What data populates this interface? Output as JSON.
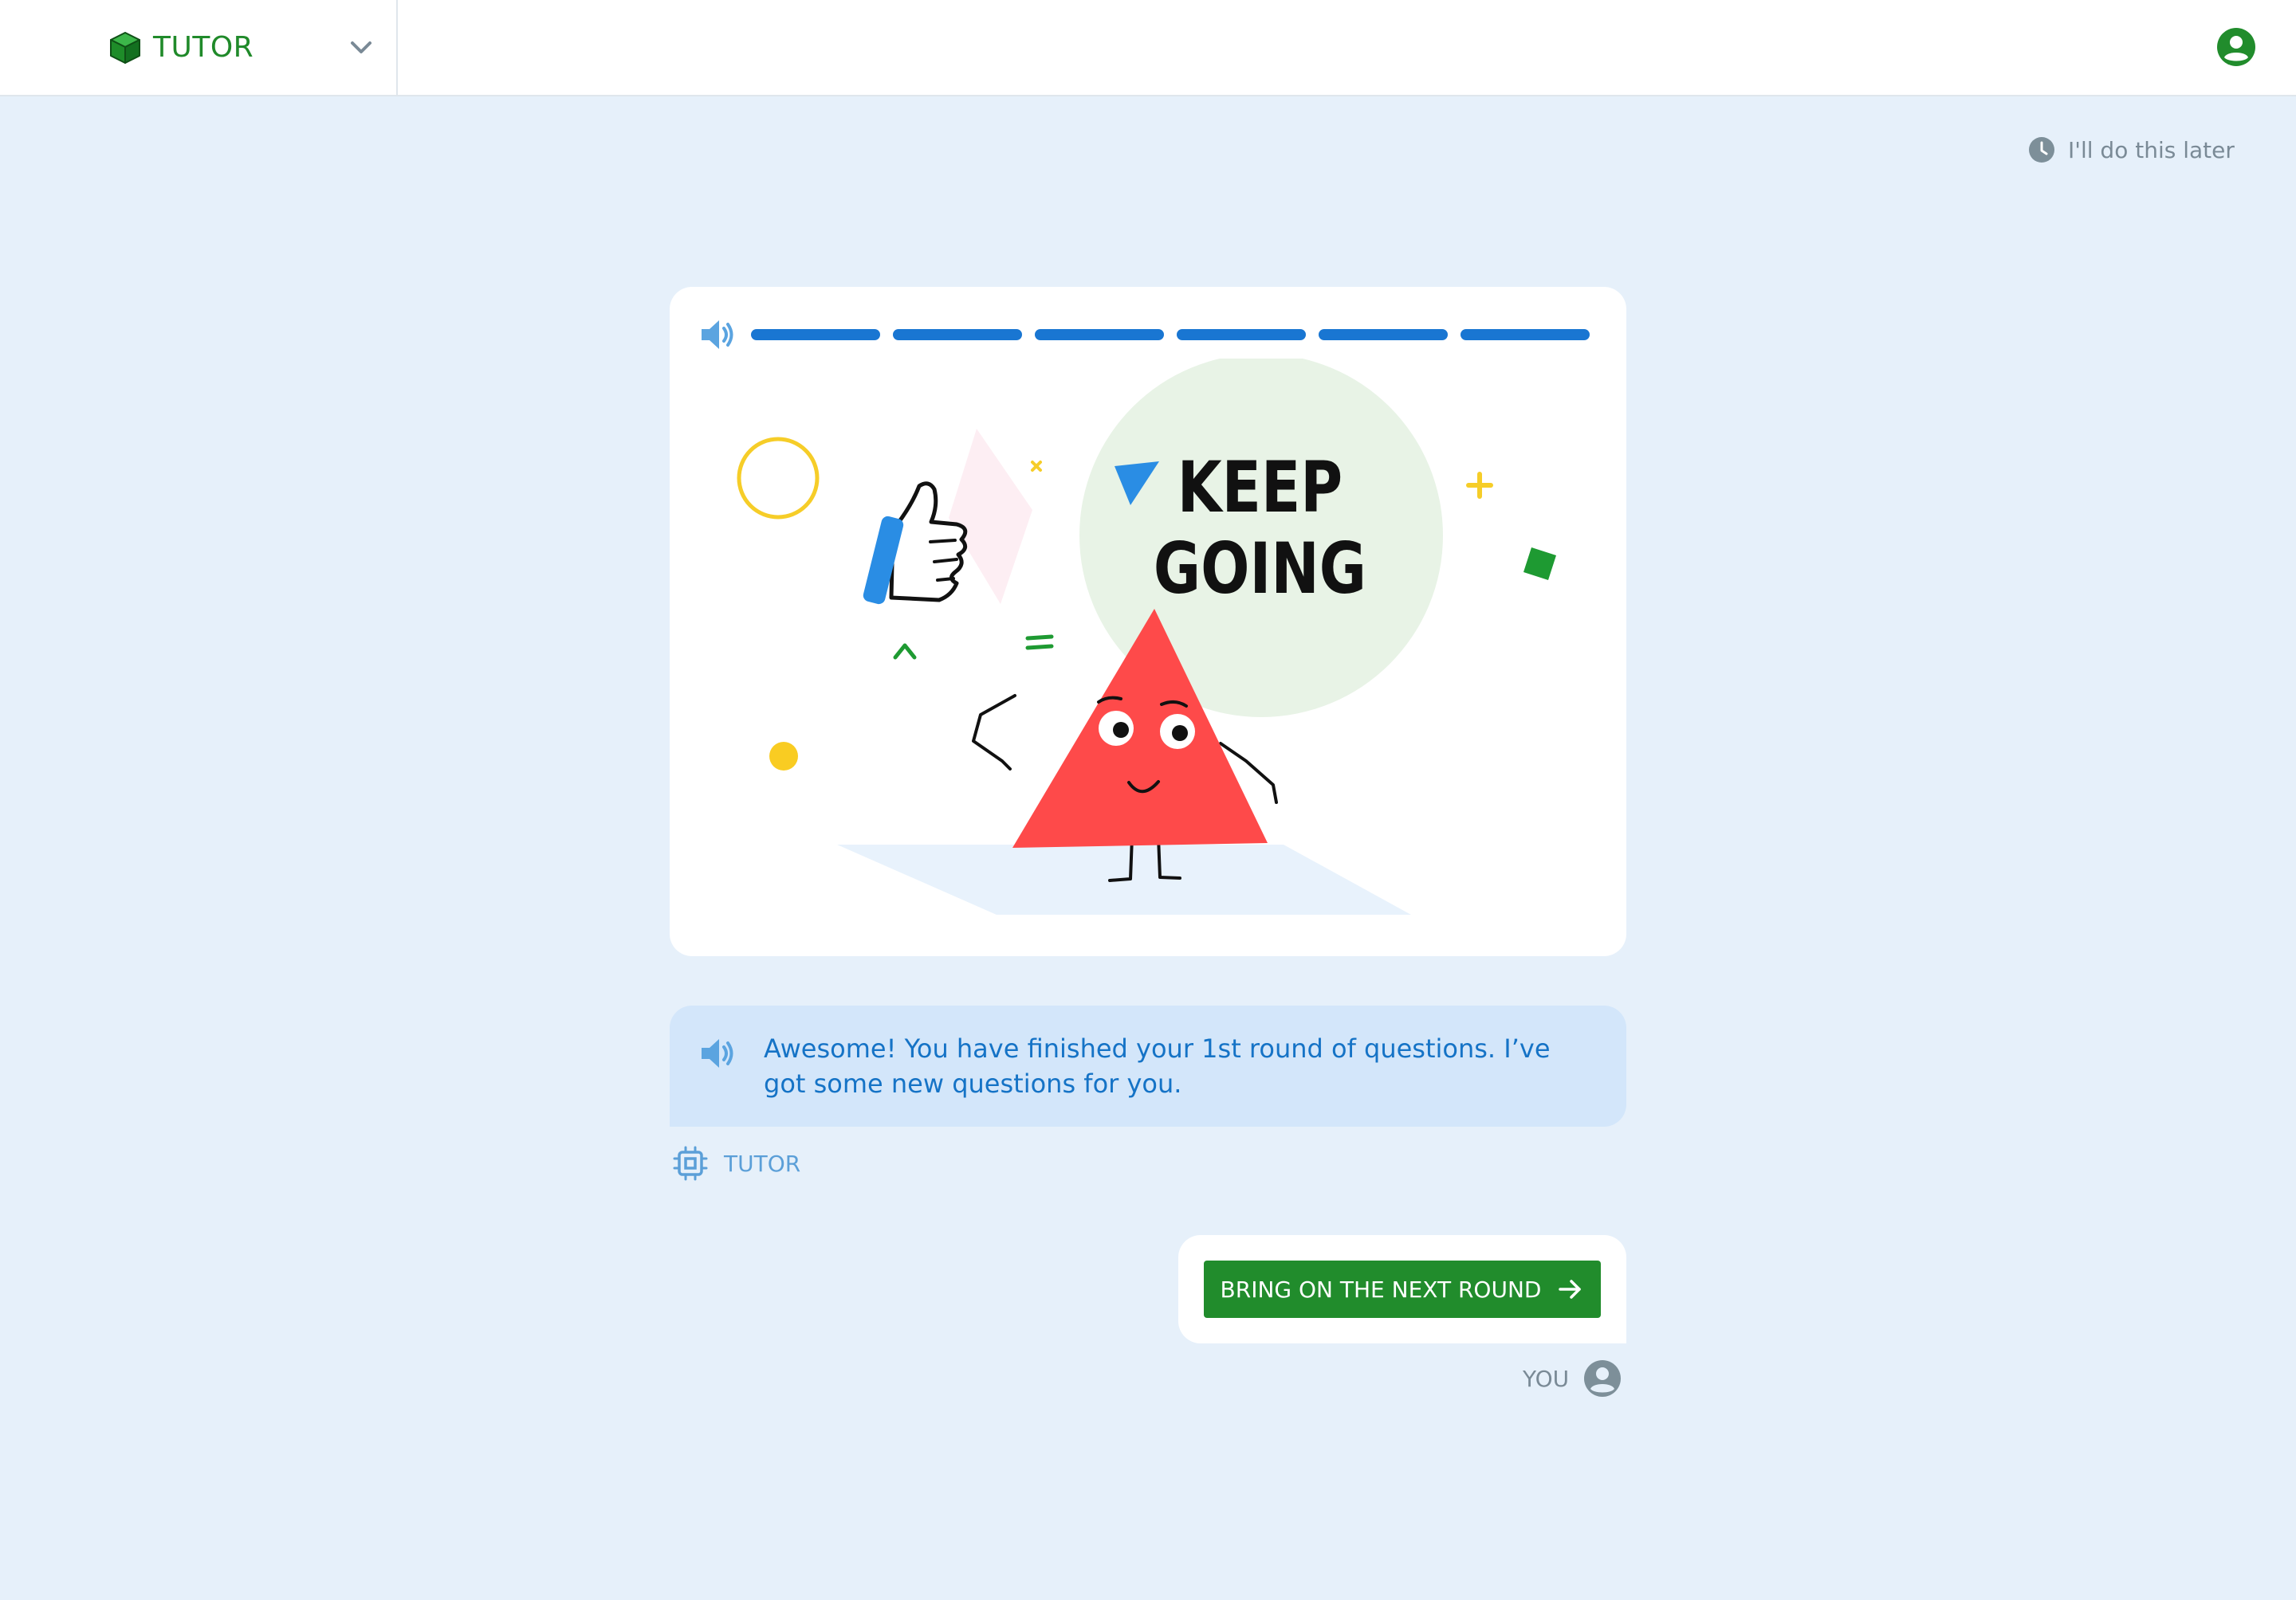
{
  "header": {
    "brand_name": "TUTOR",
    "brand_icon": "cube-icon",
    "dropdown_icon": "chevron-down-icon",
    "account_icon": "account-circle-icon",
    "accent_color": "#208a2a"
  },
  "later_link": {
    "label": "I'll do this later",
    "icon": "clock-icon"
  },
  "card": {
    "audio_icon": "speaker-icon",
    "progress": {
      "completed_segments": 6,
      "total_segments": 6,
      "color": "#1976d2"
    },
    "illustration": {
      "headline_line1": "KEEP",
      "headline_line2": "GOING"
    }
  },
  "tutor_message": {
    "text": "Awesome! You have finished your 1st round of questions. I’ve got some new questions for you.",
    "audio_icon": "speaker-icon",
    "sender_label": "TUTOR",
    "sender_icon": "chip-icon"
  },
  "user_reply": {
    "button_label": "BRING ON THE NEXT ROUND",
    "button_icon": "arrow-right-icon",
    "button_color": "#218c2c",
    "sender_label": "YOU",
    "sender_icon": "account-circle-icon"
  }
}
